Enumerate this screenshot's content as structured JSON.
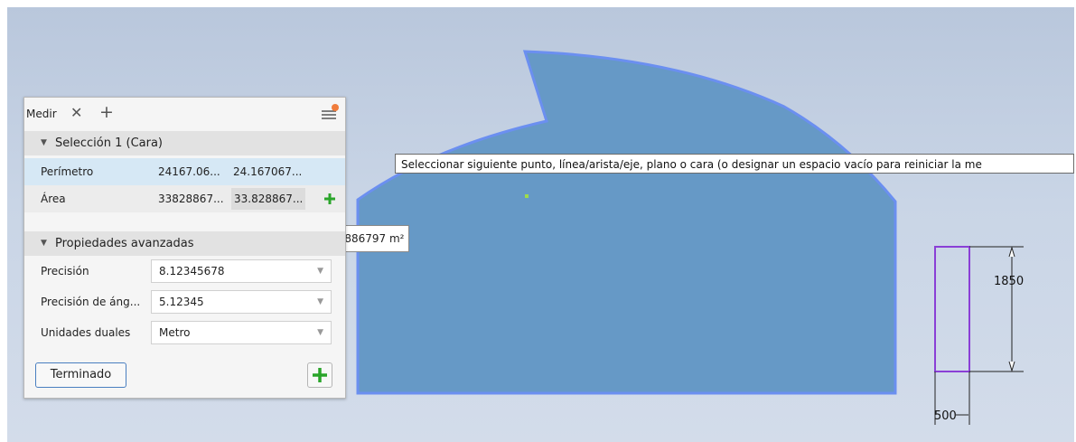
{
  "measure_panel": {
    "tab_label": "Medir",
    "selection_header": "Selección 1 (Cara)",
    "rows": [
      {
        "label": "Perímetro",
        "value1": "24167.06...",
        "value2": "24.167067..."
      },
      {
        "label": "Área",
        "value1": "33828867...",
        "value2": "33.828867..."
      }
    ],
    "advanced_header": "Propiedades avanzadas",
    "settings": [
      {
        "label": "Precisión",
        "value": "8.12345678"
      },
      {
        "label": "Precisión de áng...",
        "value": "5.12345"
      },
      {
        "label": "Unidades duales",
        "value": "Metro"
      }
    ],
    "done_label": "Terminado"
  },
  "tooltip_text": "Seleccionar siguiente punto, línea/arista/eje, plano o cara (o designar un espacio vacío para reiniciar la me",
  "area_tooltip": "33.82886797 m²",
  "dimensions": {
    "height": "1850",
    "width": "500"
  },
  "icons": [
    "close-icon",
    "plus-icon",
    "menu-icon",
    "notification-dot-icon",
    "caret-down-icon",
    "add-icon"
  ],
  "colors": {
    "face_fill": "#6699c6",
    "face_edge": "#6b8ff0",
    "rect_edge": "#8a3fd6",
    "add_green": "#2aa52a",
    "notify": "#f07c3c"
  }
}
